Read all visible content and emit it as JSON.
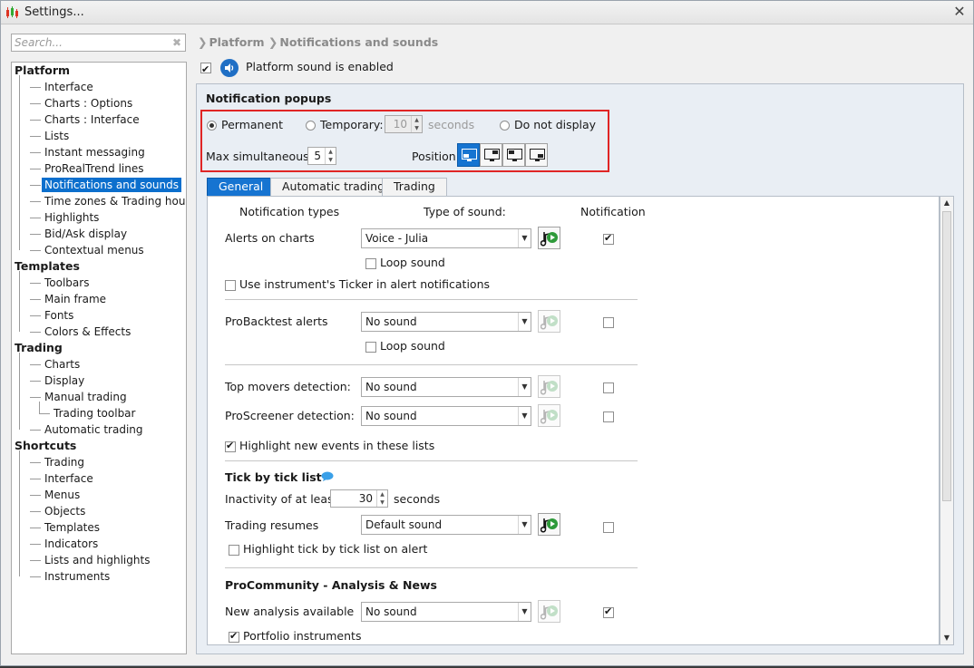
{
  "window": {
    "title": "Settings..."
  },
  "search": {
    "placeholder": "Search..."
  },
  "tree": [
    {
      "label": "Platform",
      "kind": "cat"
    },
    {
      "label": "Interface",
      "kind": "item"
    },
    {
      "label": "Charts : Options",
      "kind": "item"
    },
    {
      "label": "Charts : Interface",
      "kind": "item"
    },
    {
      "label": "Lists",
      "kind": "item"
    },
    {
      "label": "Instant messaging",
      "kind": "item"
    },
    {
      "label": "ProRealTrend lines",
      "kind": "item"
    },
    {
      "label": "Notifications and sounds",
      "kind": "item",
      "selected": true
    },
    {
      "label": "Time zones & Trading hours",
      "kind": "item"
    },
    {
      "label": "Highlights",
      "kind": "item"
    },
    {
      "label": "Bid/Ask display",
      "kind": "item"
    },
    {
      "label": "Contextual menus",
      "kind": "item"
    },
    {
      "label": "Templates",
      "kind": "cat"
    },
    {
      "label": "Toolbars",
      "kind": "item"
    },
    {
      "label": "Main frame",
      "kind": "item"
    },
    {
      "label": "Fonts",
      "kind": "item"
    },
    {
      "label": "Colors & Effects",
      "kind": "item"
    },
    {
      "label": "Trading",
      "kind": "cat"
    },
    {
      "label": "Charts",
      "kind": "item"
    },
    {
      "label": "Display",
      "kind": "item"
    },
    {
      "label": "Manual trading",
      "kind": "item"
    },
    {
      "label": "Trading toolbar",
      "kind": "sub"
    },
    {
      "label": "Automatic trading",
      "kind": "item"
    },
    {
      "label": "Shortcuts",
      "kind": "cat"
    },
    {
      "label": "Trading",
      "kind": "item"
    },
    {
      "label": "Interface",
      "kind": "item"
    },
    {
      "label": "Menus",
      "kind": "item"
    },
    {
      "label": "Objects",
      "kind": "item"
    },
    {
      "label": "Templates",
      "kind": "item"
    },
    {
      "label": "Indicators",
      "kind": "item"
    },
    {
      "label": "Lists and highlights",
      "kind": "item"
    },
    {
      "label": "Instruments",
      "kind": "item"
    }
  ],
  "breadcrumb": {
    "part1": "Platform",
    "part2": "Notifications and sounds"
  },
  "platform_sound": {
    "label": "Platform sound is enabled",
    "checked": true
  },
  "popups": {
    "title": "Notification popups",
    "permanent": "Permanent",
    "temporary": "Temporary:",
    "temporary_value": "10",
    "seconds": "seconds",
    "do_not_display": "Do not display",
    "max_label": "Max simultaneous:",
    "max_value": "5",
    "position_label": "Position"
  },
  "tabs": [
    "General",
    "Automatic trading",
    "Trading"
  ],
  "general": {
    "col_types": "Notification types",
    "col_sound": "Type of sound:",
    "col_notification": "Notification",
    "alerts_label": "Alerts on charts",
    "alerts_sound": "Voice - Julia",
    "loop_sound": "Loop sound",
    "ticker_label": "Use instrument's Ticker in alert notifications",
    "probacktest_label": "ProBacktest alerts",
    "probacktest_sound": "No sound",
    "loop_sound2": "Loop sound",
    "topmovers_label": "Top movers detection:",
    "topmovers_sound": "No sound",
    "proscreener_label": "ProScreener detection:",
    "proscreener_sound": "No sound",
    "highlight_events": "Highlight new events in these lists",
    "tick_title": "Tick by tick list",
    "inactivity_label": "Inactivity of at least",
    "inactivity_value": "30",
    "inactivity_unit": "seconds",
    "resumes_label": "Trading resumes",
    "resumes_sound": "Default sound",
    "highlight_tick": "Highlight tick by tick list on alert",
    "community_title": "ProCommunity - Analysis & News",
    "new_analysis_label": "New analysis available",
    "new_analysis_sound": "No sound",
    "portfolio_label": "Portfolio instruments"
  }
}
